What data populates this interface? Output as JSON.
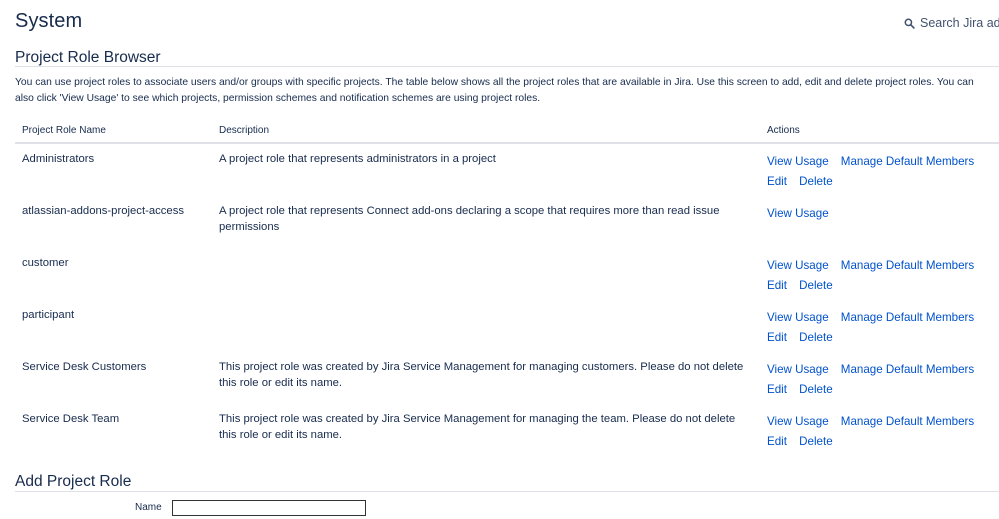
{
  "page": {
    "title": "System"
  },
  "search": {
    "label": "Search Jira adm",
    "icon": "search-icon"
  },
  "browser": {
    "title": "Project Role Browser",
    "intro_line1": "You can use project roles to associate users and/or groups with specific projects. The table below shows all the project roles that are available in Jira. Use this screen to add, edit and delete project roles. You can",
    "intro_line2": "also click 'View Usage' to see which projects, permission schemes and notification schemes are using project roles."
  },
  "table": {
    "headers": {
      "name": "Project Role Name",
      "description": "Description",
      "actions": "Actions"
    },
    "rows": [
      {
        "name": "Administrators",
        "description": "A project role that represents administrators in a project",
        "view_usage": "View Usage",
        "manage": "Manage Default Members",
        "edit": "Edit",
        "delete": "Delete"
      },
      {
        "name": "atlassian-addons-project-access",
        "description": "A project role that represents Connect add-ons declaring a scope that requires more than read issue permissions",
        "view_usage": "View Usage"
      },
      {
        "name": "customer",
        "description": "",
        "view_usage": "View Usage",
        "manage": "Manage Default Members",
        "edit": "Edit",
        "delete": "Delete"
      },
      {
        "name": "participant",
        "description": "",
        "view_usage": "View Usage",
        "manage": "Manage Default Members",
        "edit": "Edit",
        "delete": "Delete"
      },
      {
        "name": "Service Desk Customers",
        "description": "This project role was created by Jira Service Management for managing customers. Please do not delete this role or edit its name.",
        "view_usage": "View Usage",
        "manage": "Manage Default Members",
        "edit": "Edit",
        "delete": "Delete"
      },
      {
        "name": "Service Desk Team",
        "description": "This project role was created by Jira Service Management for managing the team. Please do not delete this role or edit its name.",
        "view_usage": "View Usage",
        "manage": "Manage Default Members",
        "edit": "Edit",
        "delete": "Delete"
      }
    ]
  },
  "add_role": {
    "title": "Add Project Role",
    "name_label": "Name",
    "name_value": ""
  },
  "colors": {
    "text": "#172b4d",
    "link": "#0052cc",
    "border": "#dfe1e6"
  }
}
